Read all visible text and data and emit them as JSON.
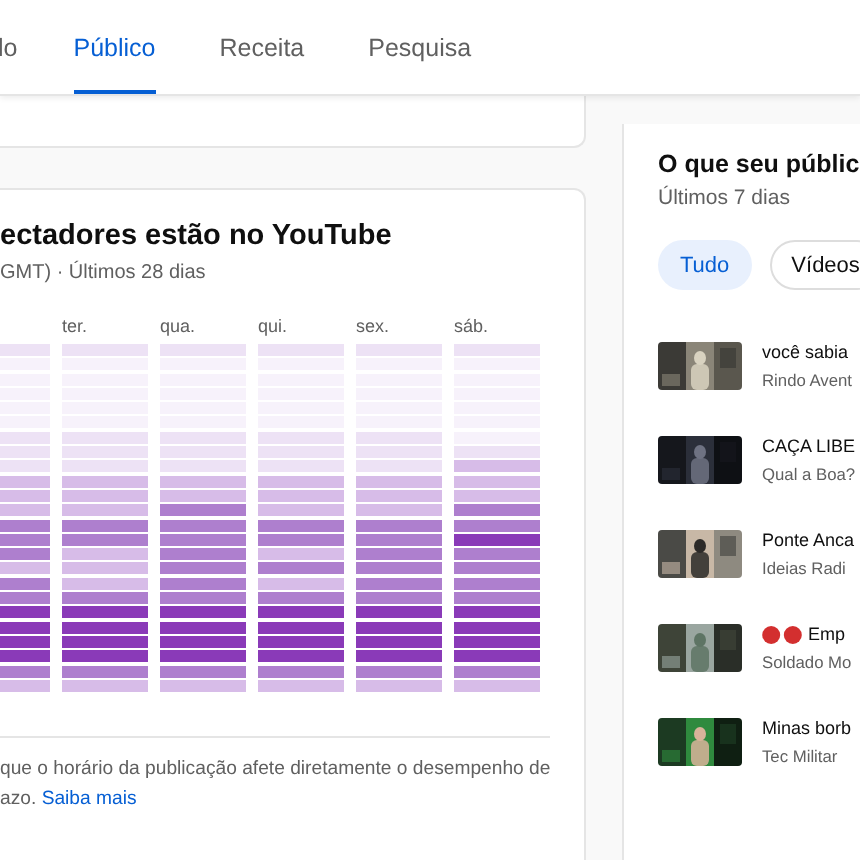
{
  "tabs": [
    {
      "label": "lo",
      "selected": false
    },
    {
      "label": "Público",
      "selected": true
    },
    {
      "label": "Receita",
      "selected": false
    },
    {
      "label": "Pesquisa",
      "selected": false
    }
  ],
  "audience_card": {
    "title": "ectadores estão no YouTube",
    "subtitle": "GMT) · Últimos 28 dias",
    "heatmap": [
      {
        "cells": [
          {
            "color": "#ede2f5"
          },
          {
            "color": "#f7f2fb"
          },
          {
            "color": "#f7f2fb"
          },
          {
            "color": "#f7f2fb"
          },
          {
            "color": "#f7f2fb"
          },
          {
            "color": "#f7f2fb"
          },
          {
            "color": "#ede2f5"
          },
          {
            "color": "#ede2f5"
          },
          {
            "color": "#ede2f5"
          },
          {
            "color": "#d7bce8"
          },
          {
            "color": "#d7bce8"
          },
          {
            "color": "#d7bce8"
          },
          {
            "color": "#ae7fce"
          },
          {
            "color": "#ae7fce"
          },
          {
            "color": "#ae7fce"
          },
          {
            "color": "#d7bce8"
          },
          {
            "color": "#ae7fce"
          },
          {
            "color": "#ae7fce"
          },
          {
            "color": "#8a3ab8"
          },
          {
            "color": "#8a3ab8"
          },
          {
            "color": "#8a3ab8"
          },
          {
            "color": "#8a3ab8"
          },
          {
            "color": "#ae7fce"
          },
          {
            "color": "#d7bce8"
          }
        ]
      },
      {
        "day": "ter.",
        "cells": [
          {
            "color": "#ede2f5"
          },
          {
            "color": "#f7f2fb"
          },
          {
            "color": "#f7f2fb"
          },
          {
            "color": "#f7f2fb"
          },
          {
            "color": "#f7f2fb"
          },
          {
            "color": "#f7f2fb"
          },
          {
            "color": "#ede2f5"
          },
          {
            "color": "#ede2f5"
          },
          {
            "color": "#ede2f5"
          },
          {
            "color": "#d7bce8"
          },
          {
            "color": "#d7bce8"
          },
          {
            "color": "#d7bce8"
          },
          {
            "color": "#ae7fce"
          },
          {
            "color": "#ae7fce"
          },
          {
            "color": "#d7bce8"
          },
          {
            "color": "#d7bce8"
          },
          {
            "color": "#d7bce8"
          },
          {
            "color": "#ae7fce"
          },
          {
            "color": "#8a3ab8"
          },
          {
            "color": "#8a3ab8"
          },
          {
            "color": "#8a3ab8"
          },
          {
            "color": "#8a3ab8"
          },
          {
            "color": "#ae7fce"
          },
          {
            "color": "#d7bce8"
          }
        ]
      },
      {
        "day": "qua.",
        "cells": [
          {
            "color": "#ede2f5"
          },
          {
            "color": "#f7f2fb"
          },
          {
            "color": "#f7f2fb"
          },
          {
            "color": "#f7f2fb"
          },
          {
            "color": "#f7f2fb"
          },
          {
            "color": "#f7f2fb"
          },
          {
            "color": "#ede2f5"
          },
          {
            "color": "#ede2f5"
          },
          {
            "color": "#ede2f5"
          },
          {
            "color": "#d7bce8"
          },
          {
            "color": "#d7bce8"
          },
          {
            "color": "#ae7fce"
          },
          {
            "color": "#ae7fce"
          },
          {
            "color": "#ae7fce"
          },
          {
            "color": "#ae7fce"
          },
          {
            "color": "#ae7fce"
          },
          {
            "color": "#ae7fce"
          },
          {
            "color": "#ae7fce"
          },
          {
            "color": "#8a3ab8"
          },
          {
            "color": "#8a3ab8"
          },
          {
            "color": "#8a3ab8"
          },
          {
            "color": "#8a3ab8"
          },
          {
            "color": "#ae7fce"
          },
          {
            "color": "#d7bce8"
          }
        ]
      },
      {
        "day": "qui.",
        "cells": [
          {
            "color": "#ede2f5"
          },
          {
            "color": "#f7f2fb"
          },
          {
            "color": "#f7f2fb"
          },
          {
            "color": "#f7f2fb"
          },
          {
            "color": "#f7f2fb"
          },
          {
            "color": "#f7f2fb"
          },
          {
            "color": "#ede2f5"
          },
          {
            "color": "#ede2f5"
          },
          {
            "color": "#ede2f5"
          },
          {
            "color": "#d7bce8"
          },
          {
            "color": "#d7bce8"
          },
          {
            "color": "#d7bce8"
          },
          {
            "color": "#ae7fce"
          },
          {
            "color": "#ae7fce"
          },
          {
            "color": "#d7bce8"
          },
          {
            "color": "#ae7fce"
          },
          {
            "color": "#d7bce8"
          },
          {
            "color": "#ae7fce"
          },
          {
            "color": "#8a3ab8"
          },
          {
            "color": "#8a3ab8"
          },
          {
            "color": "#8a3ab8"
          },
          {
            "color": "#8a3ab8"
          },
          {
            "color": "#ae7fce"
          },
          {
            "color": "#d7bce8"
          }
        ]
      },
      {
        "day": "sex.",
        "cells": [
          {
            "color": "#ede2f5"
          },
          {
            "color": "#f7f2fb"
          },
          {
            "color": "#f7f2fb"
          },
          {
            "color": "#f7f2fb"
          },
          {
            "color": "#f7f2fb"
          },
          {
            "color": "#f7f2fb"
          },
          {
            "color": "#ede2f5"
          },
          {
            "color": "#ede2f5"
          },
          {
            "color": "#ede2f5"
          },
          {
            "color": "#d7bce8"
          },
          {
            "color": "#d7bce8"
          },
          {
            "color": "#d7bce8"
          },
          {
            "color": "#ae7fce"
          },
          {
            "color": "#ae7fce"
          },
          {
            "color": "#ae7fce"
          },
          {
            "color": "#ae7fce"
          },
          {
            "color": "#ae7fce"
          },
          {
            "color": "#ae7fce"
          },
          {
            "color": "#8a3ab8"
          },
          {
            "color": "#8a3ab8"
          },
          {
            "color": "#8a3ab8"
          },
          {
            "color": "#8a3ab8"
          },
          {
            "color": "#ae7fce"
          },
          {
            "color": "#d7bce8"
          }
        ]
      },
      {
        "day": "sáb.",
        "cells": [
          {
            "color": "#ede2f5"
          },
          {
            "color": "#f7f2fb"
          },
          {
            "color": "#f7f2fb"
          },
          {
            "color": "#f7f2fb"
          },
          {
            "color": "#f7f2fb"
          },
          {
            "color": "#f7f2fb"
          },
          {
            "color": "#f7f2fb"
          },
          {
            "color": "#ede2f5"
          },
          {
            "color": "#d7bce8"
          },
          {
            "color": "#d7bce8"
          },
          {
            "color": "#d7bce8"
          },
          {
            "color": "#ae7fce"
          },
          {
            "color": "#ae7fce"
          },
          {
            "color": "#8a3ab8"
          },
          {
            "color": "#ae7fce"
          },
          {
            "color": "#ae7fce"
          },
          {
            "color": "#ae7fce"
          },
          {
            "color": "#ae7fce"
          },
          {
            "color": "#8a3ab8"
          },
          {
            "color": "#8a3ab8"
          },
          {
            "color": "#8a3ab8"
          },
          {
            "color": "#8a3ab8"
          },
          {
            "color": "#ae7fce"
          },
          {
            "color": "#d7bce8"
          }
        ]
      }
    ],
    "note_lines": [
      "que o horário da publicação afete diretamente o desempenho de",
      "azo."
    ],
    "note_link": "Saiba mais"
  },
  "watching_card": {
    "title": "O que seu públic",
    "subtitle": "Últimos 7 dias",
    "chips": [
      {
        "label": "Tudo",
        "selected": true
      },
      {
        "label": "Vídeos",
        "selected": false
      }
    ],
    "videos": [
      {
        "kind": "plain",
        "title": "você sabia",
        "channel": "Rindo Avent"
      },
      {
        "kind": "plain",
        "title": "CAÇA LIBE",
        "channel": "Qual a Boa?"
      },
      {
        "kind": "plain",
        "title": "Ponte Anca",
        "channel": "Ideias Radi"
      },
      {
        "kind": "dotted",
        "title": "Emp",
        "channel": "Soldado Mo"
      },
      {
        "kind": "plain",
        "title": "Minas borb",
        "channel": "Tec Militar"
      }
    ]
  }
}
